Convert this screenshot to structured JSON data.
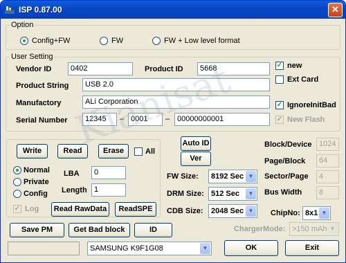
{
  "window": {
    "title": "ISP 0.87.00",
    "close_glyph": "✕"
  },
  "option": {
    "title": "Option",
    "radios": [
      {
        "label": "Config+FW",
        "selected": true
      },
      {
        "label": "FW",
        "selected": false
      },
      {
        "label": "FW + Low level format",
        "selected": false
      }
    ]
  },
  "user_setting": {
    "title": "User Setting",
    "vendor_id": {
      "label": "Vendor ID",
      "value": "0402"
    },
    "product_id": {
      "label": "Product ID",
      "value": "5668"
    },
    "product_string": {
      "label": "Product String",
      "value": "USB 2.0"
    },
    "manufactory": {
      "label": "Manufactory",
      "value": "ALi Corporation"
    },
    "serial_number": {
      "label": "Serial Number",
      "part1": "12345",
      "part2": "0001",
      "part3": "00000000001",
      "separator": "–"
    },
    "new": {
      "label": "new",
      "checked": true
    },
    "ext_card": {
      "label": "Ext Card",
      "checked": false
    },
    "ignore_init_bad": {
      "label": "IgnoreInitBad",
      "checked": true
    },
    "new_flash": {
      "label": "New Flash",
      "checked": true,
      "disabled": true
    }
  },
  "lower": {
    "write": "Write",
    "read": "Read",
    "erase": "Erase",
    "all": {
      "label": "All",
      "checked": false
    },
    "normal": {
      "label": "Normal",
      "selected": true
    },
    "private": {
      "label": "Private",
      "selected": false
    },
    "config": {
      "label": "Config",
      "selected": false
    },
    "lba": {
      "label": "LBA",
      "value": "0"
    },
    "length": {
      "label": "Length",
      "value": "1"
    },
    "log": {
      "label": "Log",
      "checked": true,
      "disabled": true
    },
    "read_raw": "Read RawData",
    "read_spe": "ReadSPE"
  },
  "middle": {
    "auto_id": "Auto ID",
    "ver": "Ver",
    "fw_size": {
      "label": "FW Size:",
      "value": "8192 Sec"
    },
    "drm_size": {
      "label": "DRM Size:",
      "value": "512 Sec"
    },
    "cdb_size": {
      "label": "CDB Size:",
      "value": "2048 Sec"
    }
  },
  "right": {
    "block_device": {
      "label": "Block/Device",
      "value": "1024"
    },
    "page_block": {
      "label": "Page/Block",
      "value": "64"
    },
    "sector_page": {
      "label": "Sector/Page",
      "value": "4"
    },
    "bus_width": {
      "label": "Bus Width",
      "value": "8"
    },
    "chip_no": {
      "label": "ChipNo:",
      "value": "8x1"
    },
    "charger_mode": {
      "label": "ChargerMode:",
      "value": ">150 mAh"
    }
  },
  "bottom": {
    "save_pm": "Save PM",
    "get_bad_block": "Get Bad block",
    "id": "ID",
    "status": "",
    "chip_select": "SAMSUNG K9F1G08",
    "ok": "OK",
    "exit": "Exit"
  },
  "watermark": "Kianisat",
  "combo_arrow": "▼",
  "check_glyph": "✓"
}
